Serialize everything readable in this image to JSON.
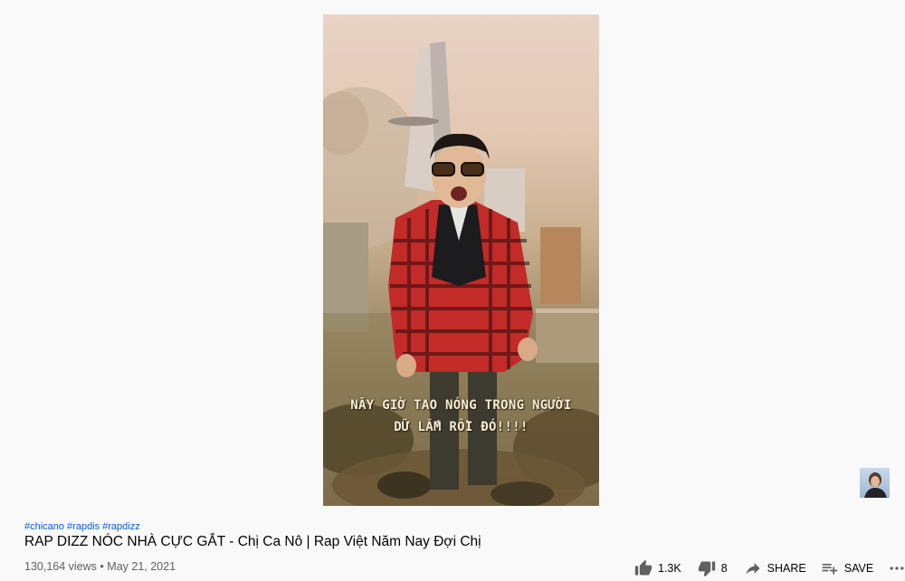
{
  "video": {
    "caption_line1": "NÃY GIỜ TAO NÓNG TRONG NGƯỜI",
    "caption_line2": "DỮ LẮM RỒI ĐÓ!!!!"
  },
  "hashtags": [
    "#chicano",
    "#rapdis",
    "#rapdizz"
  ],
  "title": "RAP DIZZ NÓC NHÀ CỰC GẮT - Chị Ca Nô | Rap Việt Năm Nay Đợi Chị",
  "info": {
    "views": "130,164 views",
    "separator": "•",
    "date": "May 21, 2021"
  },
  "actions": {
    "like_count": "1.3K",
    "dislike_count": "8",
    "share_label": "SHARE",
    "save_label": "SAVE"
  },
  "icons": {
    "like": "thumb-up-icon",
    "dislike": "thumb-down-icon",
    "share": "share-arrow-icon",
    "save": "playlist-add-icon",
    "more": "more-horiz-icon"
  }
}
